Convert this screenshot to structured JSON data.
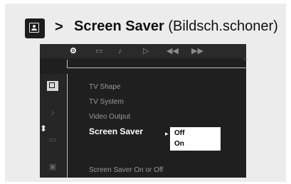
{
  "header": {
    "arrow": ">",
    "title": "Screen Saver",
    "subtitle": "(Bildsch.schoner)"
  },
  "osd": {
    "top_icons": [
      {
        "name": "settings-icon",
        "glyph": "⚙"
      },
      {
        "name": "subtitle-icon",
        "glyph": "▭"
      },
      {
        "name": "audio-icon",
        "glyph": "♪"
      },
      {
        "name": "play-icon",
        "glyph": "▷"
      },
      {
        "name": "rewind-icon",
        "glyph": "◀◀"
      },
      {
        "name": "forward-icon",
        "glyph": "▶▶"
      }
    ],
    "menu_items": [
      {
        "label": "TV Shape",
        "selected": false
      },
      {
        "label": "TV System",
        "selected": false
      },
      {
        "label": "Video Output",
        "selected": false
      },
      {
        "label": "Screen Saver",
        "selected": true
      }
    ],
    "submenu_options": [
      "Off",
      "On"
    ],
    "status": "Screen Saver On or Off"
  }
}
